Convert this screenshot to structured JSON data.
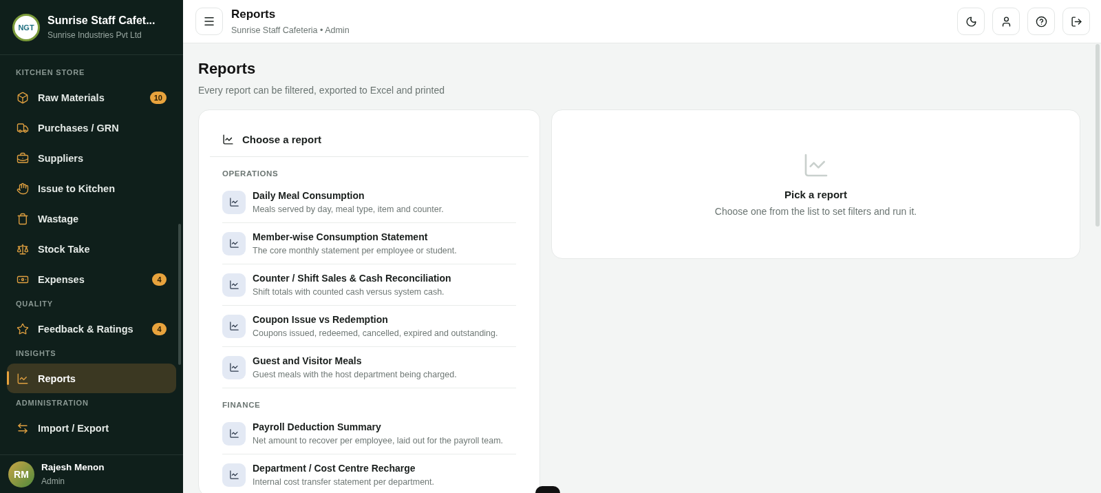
{
  "sidebar": {
    "brand": {
      "logo_text": "NGT",
      "title": "Sunrise Staff Cafet...",
      "subtitle": "Sunrise Industries Pvt Ltd"
    },
    "sections": [
      {
        "label": "KITCHEN STORE",
        "items": [
          {
            "label": "Raw Materials",
            "badge": "10",
            "selected": false
          },
          {
            "label": "Purchases / GRN",
            "selected": false
          },
          {
            "label": "Suppliers",
            "selected": false
          },
          {
            "label": "Issue to Kitchen",
            "selected": false
          },
          {
            "label": "Wastage",
            "selected": false
          },
          {
            "label": "Stock Take",
            "selected": false
          },
          {
            "label": "Expenses",
            "badge": "4",
            "selected": false
          }
        ]
      },
      {
        "label": "QUALITY",
        "items": [
          {
            "label": "Feedback & Ratings",
            "badge": "4",
            "selected": false
          }
        ]
      },
      {
        "label": "INSIGHTS",
        "items": [
          {
            "label": "Reports",
            "selected": true
          }
        ]
      },
      {
        "label": "ADMINISTRATION",
        "items": [
          {
            "label": "Import / Export",
            "selected": false
          }
        ]
      }
    ],
    "user": {
      "initials": "RM",
      "name": "Rajesh Menon",
      "role": "Admin"
    }
  },
  "header": {
    "title": "Reports",
    "subtitle": "Sunrise Staff Cafeteria • Admin"
  },
  "page": {
    "title": "Reports",
    "subtitle": "Every report can be filtered, exported to Excel and printed"
  },
  "report_list": {
    "title": "Choose a report",
    "groups": [
      {
        "label": "OPERATIONS",
        "reports": [
          {
            "title": "Daily Meal Consumption",
            "description": "Meals served by day, meal type, item and counter."
          },
          {
            "title": "Member-wise Consumption Statement",
            "description": "The core monthly statement per employee or student."
          },
          {
            "title": "Counter / Shift Sales & Cash Reconciliation",
            "description": "Shift totals with counted cash versus system cash."
          },
          {
            "title": "Coupon Issue vs Redemption",
            "description": "Coupons issued, redeemed, cancelled, expired and outstanding."
          },
          {
            "title": "Guest and Visitor Meals",
            "description": "Guest meals with the host department being charged."
          }
        ]
      },
      {
        "label": "FINANCE",
        "reports": [
          {
            "title": "Payroll Deduction Summary",
            "description": "Net amount to recover per employee, laid out for the payroll team."
          },
          {
            "title": "Department / Cost Centre Recharge",
            "description": "Internal cost transfer statement per department."
          }
        ]
      }
    ]
  },
  "empty_state": {
    "title": "Pick a report",
    "message": "Choose one from the list to set filters and run it."
  }
}
